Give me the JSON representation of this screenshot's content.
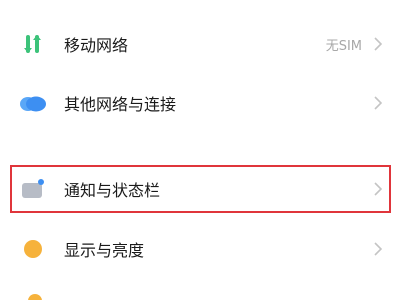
{
  "settings": {
    "items": [
      {
        "label": "移动网络",
        "value": "无SIM",
        "icon": "mobile-data-icon"
      },
      {
        "label": "其他网络与连接",
        "value": "",
        "icon": "cloud-connection-icon"
      },
      {
        "label": "通知与状态栏",
        "value": "",
        "icon": "notification-statusbar-icon",
        "highlighted": true
      },
      {
        "label": "显示与亮度",
        "value": "",
        "icon": "display-brightness-icon"
      }
    ]
  },
  "colors": {
    "highlight_border": "#e0353b",
    "mobile_green": "#3cc37a",
    "cloud_blue": "#3d8ff2",
    "notification_gray": "#b7bcc6",
    "notification_dot": "#3d8ff2",
    "display_orange": "#f6b23b",
    "value_gray": "#a8a8a8",
    "chevron_gray": "#c4c4c4"
  }
}
